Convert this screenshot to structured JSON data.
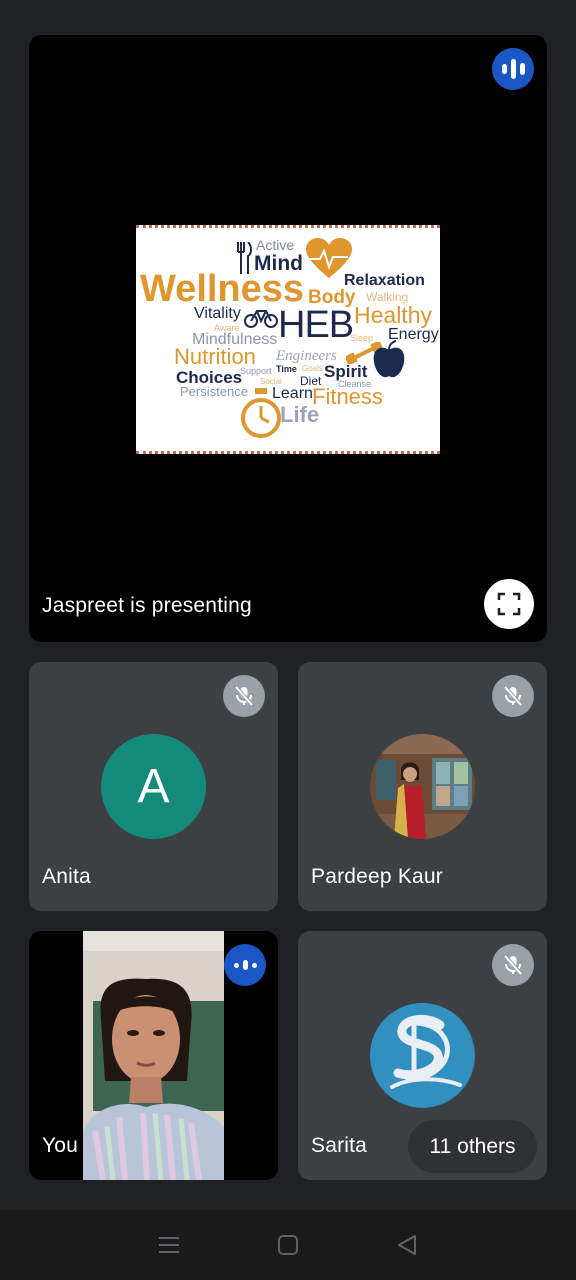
{
  "presenter": {
    "label": "Jaspreet is presenting",
    "slide_words": {
      "w1": "Active",
      "w2": "Mind",
      "w3": "Wellness",
      "w4": "Relaxation",
      "w5": "Body",
      "w6": "Walking",
      "w7": "Healthy",
      "w8": "Vitality",
      "w9": "Aware",
      "w10": "HEB",
      "w11": "Energy",
      "w12": "Mindfulness",
      "w13": "Sleep",
      "w14": "Nutrition",
      "w15": "Engineers",
      "w16": "Choices",
      "w17": "Support",
      "w18": "Time",
      "w19": "Goals",
      "w20": "Spirit",
      "w21": "Social",
      "w22": "Diet",
      "w23": "Cleanse",
      "w24": "Persistence",
      "w25": "Learn",
      "w26": "Fitness",
      "w27": "Life"
    }
  },
  "participants": {
    "anita": {
      "name": "Anita",
      "initial": "A"
    },
    "pardeep": {
      "name": "Pardeep Kaur"
    },
    "you": {
      "name": "You"
    },
    "sarita": {
      "name": "Sarita"
    }
  },
  "others": {
    "label": "11 others"
  },
  "colors": {
    "background": "#202124",
    "tile": "#3c4043",
    "speaking_badge": "#1a56c4",
    "muted_badge": "#9aa0a6",
    "avatar_anita": "#148a7a",
    "wordcloud_orange": "#e0962e",
    "wordcloud_navy": "#1d2a4f"
  }
}
